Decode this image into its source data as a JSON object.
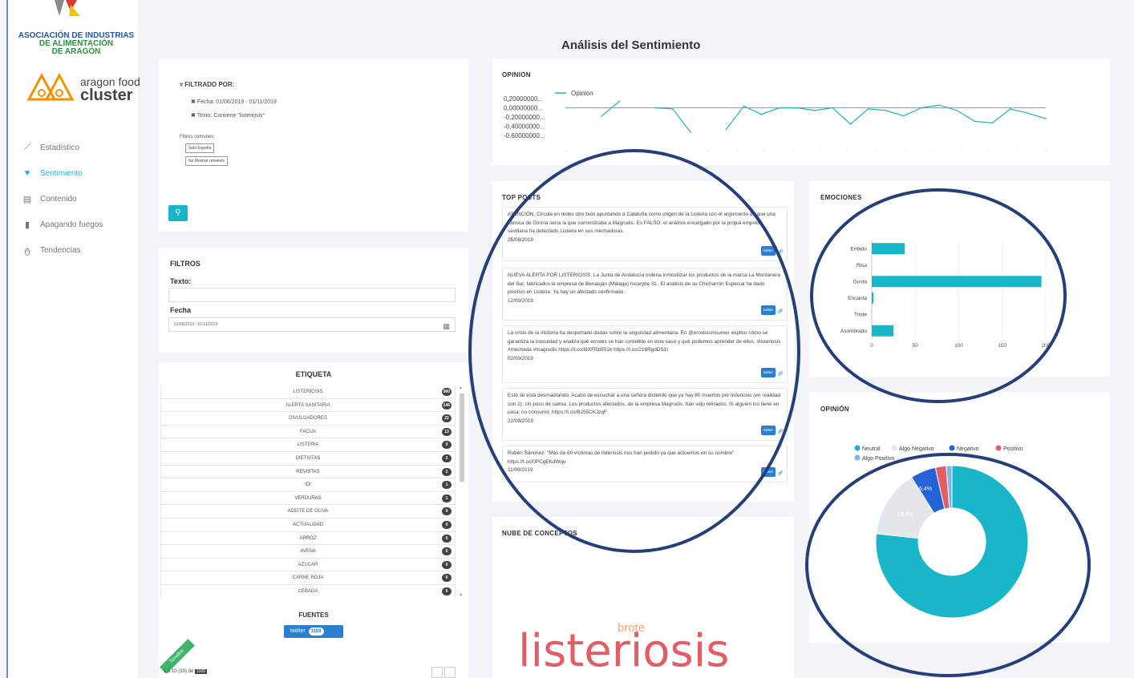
{
  "sidebar": {
    "association": [
      "ASOCIACIÓN DE INDUSTRIAS",
      "DE ALIMENTACIÓN",
      "DE ARAGÓN"
    ],
    "cluster_name_1": "aragon food",
    "cluster_name_2": "cluster",
    "items": [
      {
        "label": "Estadístico",
        "icon": "chart-icon"
      },
      {
        "label": "Sentimiento",
        "icon": "heart-icon"
      },
      {
        "label": "Contenido",
        "icon": "document-icon"
      },
      {
        "label": "Apagando fuegos",
        "icon": "fire-extinguisher-icon"
      },
      {
        "label": "Tendencias",
        "icon": "trend-icon"
      }
    ]
  },
  "page_title": "Análisis del Sentimiento",
  "filter": {
    "heading": "FILTRADO POR:",
    "lines": [
      "Fecha: 01/06/2019 - 01/11/2019",
      "Texto: Contiene \"listeriosis\""
    ],
    "common_label": "Filtros comunes:",
    "chip1": "Solo España",
    "chip2": "No Mostrar retweets"
  },
  "filtros": {
    "title": "FILTROS",
    "texto_label": "Texto:",
    "fecha_label": "Fecha",
    "fecha_value": "01/06/2019 - 01/11/2019"
  },
  "etiqueta": {
    "title": "ETIQUETA",
    "rows": [
      {
        "label": "LISTERIOSIS",
        "count": "980"
      },
      {
        "label": "ALERTA SANITARIA",
        "count": "146"
      },
      {
        "label": "DIVULGADORES",
        "count": "22"
      },
      {
        "label": "FACUA",
        "count": "13"
      },
      {
        "label": "LISTERIA",
        "count": "3"
      },
      {
        "label": "DIETISTAS",
        "count": "2"
      },
      {
        "label": "REVISTAS",
        "count": "2"
      },
      {
        "label": "IDI",
        "count": "1"
      },
      {
        "label": "VERDURAS",
        "count": "1"
      },
      {
        "label": "ACEITE DE OLIVA",
        "count": "0"
      },
      {
        "label": "ACTUALIDAD",
        "count": "0"
      },
      {
        "label": "ARROZ",
        "count": "0"
      },
      {
        "label": "AVENA",
        "count": "0"
      },
      {
        "label": "AZUCAR",
        "count": "0"
      },
      {
        "label": "CARNE ROJA",
        "count": "0"
      },
      {
        "label": "CEBADA",
        "count": "0"
      }
    ]
  },
  "fuentes": {
    "title": "FUENTES",
    "source": "twitter",
    "count": "1169"
  },
  "timeline": {
    "tag": "Timeline",
    "paging": "1 a 10 (10) de"
  },
  "opinion_line": {
    "title": "OPINION",
    "legend": "Opinion",
    "yticks": [
      "0,20000000...",
      "0,00000000...",
      "-0,20000000...",
      "-0,40000000...",
      "-0,60000000..."
    ]
  },
  "top_posts": {
    "title": "TOP POSTS",
    "posts": [
      {
        "text": "ATENCIÓN. Circula en redes otro bulo apuntando a Cataluña como origen de la Listeria con el argumento de que una cárnica de Girona sería la que suministraba a Magrudis. Es FALSO: el análisis encargado por la propia empresa sevillana ha detectado Listeria en sus mechadoras.",
        "date": "25/08/2019"
      },
      {
        "text": "NUEVA ALERTA POR LISTERIOSIS. La Junta de Andalucía ordena inmovilizar los productos de la marca La Montanera del Sur, fabricados la empresa de Benaoján (Málaga) Incarybe SL. El análisis de su Chicharrón Especial ha dado positivo en Listeria. Ya hay un afectado confirmado.",
        "date": "12/09/2019"
      },
      {
        "text": "La crisis de la #listeria ha despertado dudas sobre la seguridad alimentaria. En @eroskiconsumer explico cómo se garantiza la inocuidad y analizo qué errores se han cometido en este caso y qué podemos aprender de ellos. #listeriosis #mechada #magrudis https://t.co/I8XFRb551b https://t.co/216RgdDS1I",
        "date": "02/09/2019"
      },
      {
        "text": "Esto se está desmadrando. Acabo de escuchar a una señora diciendo que ya hay 80 muertos por listeriosis (en realidad son 2). Un poco de calma. Los productos afectados, de la empresa Magrudis, han sido retirados. Si alguien los tiene en casa: no consumir. https://t.co/B255CKJzqF",
        "date": "22/08/2019"
      },
      {
        "text": "Rubén Sánchez: \"Más de 60 víctimas de listeriosis nos han pedido ya que actuemos en su nombre\" https://t.co/0PCgEKdWqu",
        "date": "11/09/2019"
      }
    ],
    "tag": "twitter"
  },
  "nube": {
    "title": "NUBE DE CONCEPTOS",
    "word_big": "listeriosis",
    "word_small": "brote"
  },
  "emociones": {
    "title": "EMOCIONES"
  },
  "opinion_pie": {
    "title": "OPINIÓN",
    "legend": [
      {
        "label": "Neutral",
        "color": "#18b6c8"
      },
      {
        "label": "Algo Negativo",
        "color": "#e4e7ea"
      },
      {
        "label": "Negativo",
        "color": "#2563d9"
      },
      {
        "label": "Positivo",
        "color": "#e15e66"
      },
      {
        "label": "Algo Positivo",
        "color": "#7ab8e8"
      }
    ],
    "labels": {
      "neutral": "76,7%",
      "algo_negativo": "14,4%",
      "negativo": "5,4%"
    }
  },
  "chart_data": [
    {
      "type": "line",
      "title": "OPINION",
      "series": [
        {
          "name": "Opinion",
          "values": [
            0.0,
            null,
            -0.15,
            0.12,
            null,
            0.0,
            -0.02,
            -0.45,
            null,
            -0.4,
            0.03,
            -0.12,
            0.0,
            0.0,
            -0.05,
            0.0,
            -0.3,
            -0.02,
            -0.05,
            -0.15,
            0.0,
            0.05,
            -0.05,
            -0.25,
            -0.28,
            -0.02,
            -0.1,
            -0.2
          ]
        }
      ],
      "ylim": [
        -0.6,
        0.2
      ]
    },
    {
      "type": "bar",
      "title": "EMOCIONES",
      "categories": [
        "Enfado",
        "Risa",
        "Gusta",
        "Encanta",
        "Triste",
        "Asombrado"
      ],
      "values": [
        38,
        0,
        195,
        2,
        0,
        25
      ],
      "xlim": [
        0,
        200
      ],
      "xticks": [
        "0",
        "50",
        "100",
        "150",
        "200"
      ]
    },
    {
      "type": "pie",
      "title": "OPINIÓN",
      "categories": [
        "Neutral",
        "Algo Negativo",
        "Negativo",
        "Positivo",
        "Algo Positivo"
      ],
      "values": [
        76.7,
        14.4,
        5.4,
        2.3,
        1.2
      ]
    }
  ]
}
